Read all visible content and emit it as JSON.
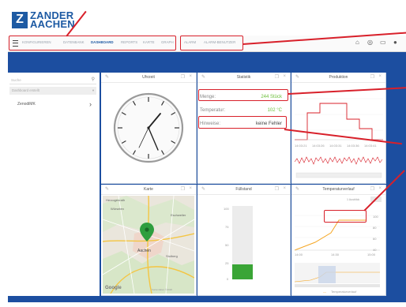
{
  "logo": {
    "mark": "Z",
    "line1": "ZANDER",
    "line2": "AACHEN"
  },
  "nav": {
    "items": [
      {
        "label": "Konfigurieren",
        "active": false
      },
      {
        "label": "Datenbank",
        "active": false
      },
      {
        "label": "Dashboard",
        "active": true
      },
      {
        "label": "Reports",
        "active": false
      },
      {
        "label": "Karte",
        "active": false
      },
      {
        "label": "Graph",
        "active": false
      },
      {
        "label": "Alarm",
        "active": false
      },
      {
        "label": "Alarm-Benutzer",
        "active": false
      }
    ],
    "icons": [
      "home-icon",
      "globe-icon",
      "monitor-icon",
      "user-icon"
    ]
  },
  "sidebar": {
    "search_placeholder": "Suche",
    "dropdown": "Dashboard erstellt",
    "items": [
      {
        "label": "ZenodiMK"
      }
    ]
  },
  "widgets": {
    "clock": {
      "title": "Uhrzeit"
    },
    "stats": {
      "title": "Statistik",
      "rows": [
        {
          "label": "Menge:",
          "value": "244 Stück"
        },
        {
          "label": "Temperatur:",
          "value": "102 °C"
        },
        {
          "label": "Hinweise:",
          "value": "keine Fehler"
        }
      ]
    },
    "production": {
      "title": "Produktion",
      "x_ticks": [
        "14:03:21",
        "14:03:26",
        "14:03:31",
        "14:03:36",
        "14:03:41"
      ]
    },
    "map": {
      "title": "Karte",
      "places": [
        "Würselen",
        "Aachen",
        "Stolberg",
        "Eschweiler",
        "Herzogenrath"
      ],
      "provider": "Google",
      "attribution": "Kartendaten ©2020"
    },
    "fill": {
      "title": "Füllstand",
      "ticks": [
        "100",
        "75",
        "50",
        "25",
        "0"
      ],
      "level": 0.2
    },
    "temperature": {
      "title": "Temperaturverlauf",
      "range_label": "1 Ausblick",
      "y_ticks": [
        "100",
        "80",
        "60",
        "40"
      ],
      "x_ticks": [
        "14:00",
        "14:30",
        "15:00"
      ],
      "legend": "Temperaturverlauf"
    }
  },
  "colors": {
    "brand": "#1d5aa3",
    "background": "#1c4ea0",
    "highlight": "#d8202a",
    "accent_green": "#6cbf3a",
    "chart_red": "#d8202a",
    "line_orange": "#f5a623"
  }
}
